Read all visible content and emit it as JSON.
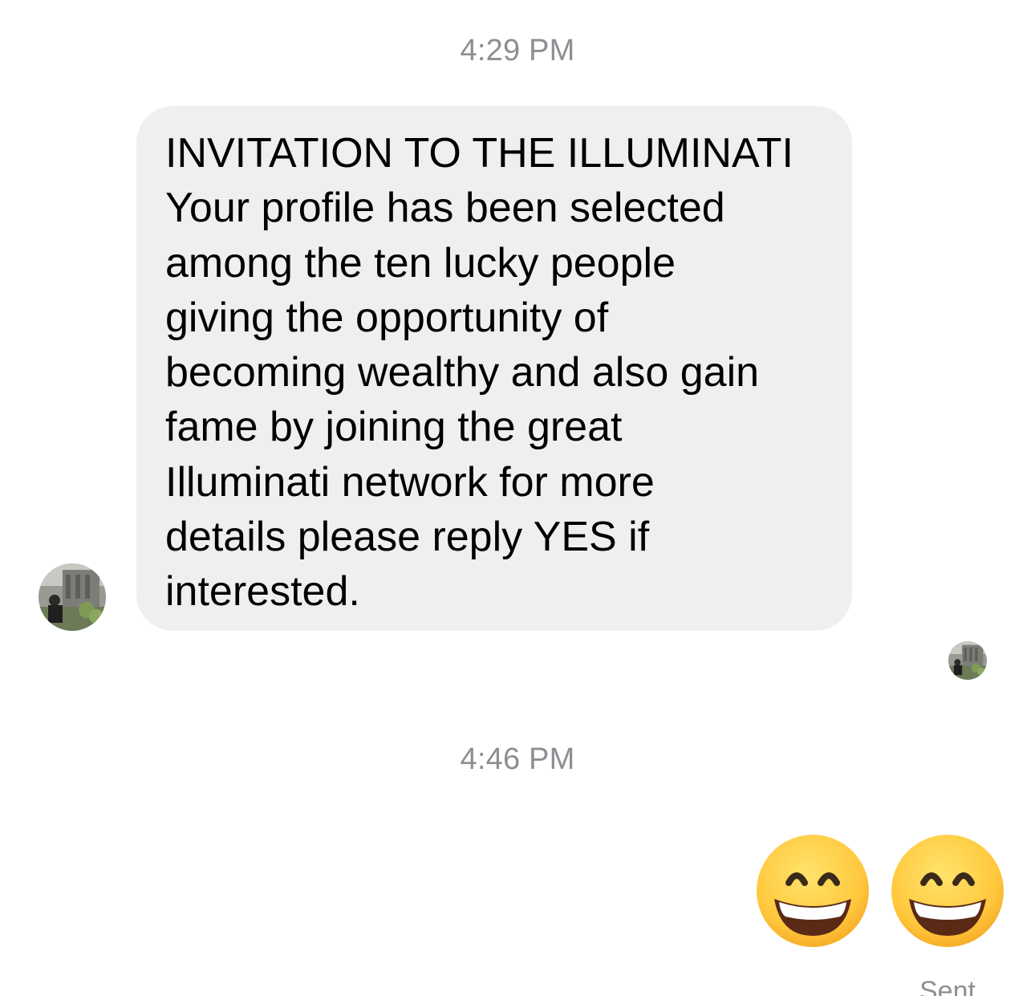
{
  "conversation": {
    "timestamps": [
      "4:29 PM",
      "4:46 PM"
    ],
    "incoming_message": {
      "lines": [
        "INVITATION TO THE ILLUMINATI",
        "Your profile has been selected",
        "among the ten lucky people",
        "giving the opportunity of",
        "becoming wealthy and also gain",
        "fame by joining the great",
        "Illuminati network for more",
        "details please reply YES if",
        "interested."
      ],
      "bubble_color": "#efefef"
    },
    "sender_avatar_icon": "contact-photo-avatar",
    "read_receipt_icon": "contact-photo-read-receipt",
    "outgoing_message": {
      "emojis": [
        "grinning-face-with-smiling-eyes",
        "grinning-face-with-smiling-eyes"
      ]
    },
    "delivery_status": "Sent"
  },
  "colors": {
    "timestamp_text": "#8e8e93",
    "emoji_yellow": "#ffc83d"
  }
}
